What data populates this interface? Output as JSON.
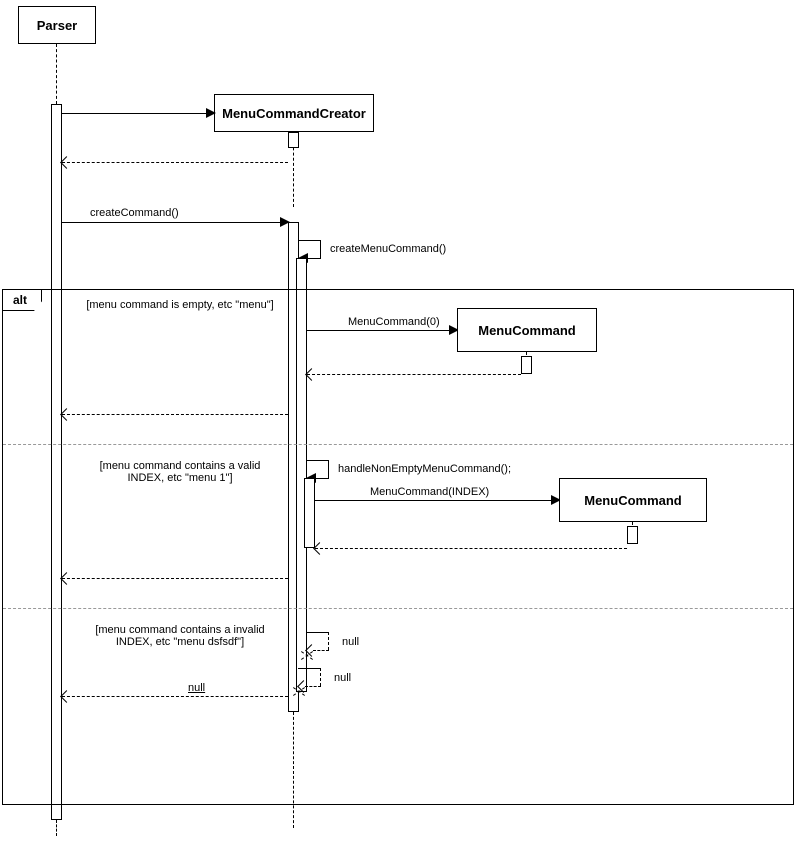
{
  "participants": {
    "parser": "Parser",
    "creator": "MenuCommandCreator",
    "menucmd1": "MenuCommand",
    "menucmd2": "MenuCommand"
  },
  "messages": {
    "createCommand": "createCommand()",
    "createMenuCommand": "createMenuCommand()",
    "menuCommand0": "MenuCommand(0)",
    "handleNonEmpty": "handleNonEmptyMenuCommand();",
    "menuCommandIndex": "MenuCommand(INDEX)",
    "null1": "null",
    "null2": "null",
    "null3": "null"
  },
  "frames": {
    "altLabel": "alt",
    "guard1": "[menu command is empty, etc \"menu\"]",
    "guard2": "[menu command contains a valid INDEX, etc \"menu 1\"]",
    "guard3": "[menu command contains a invalid INDEX, etc \"menu dsfsdf\"]"
  }
}
